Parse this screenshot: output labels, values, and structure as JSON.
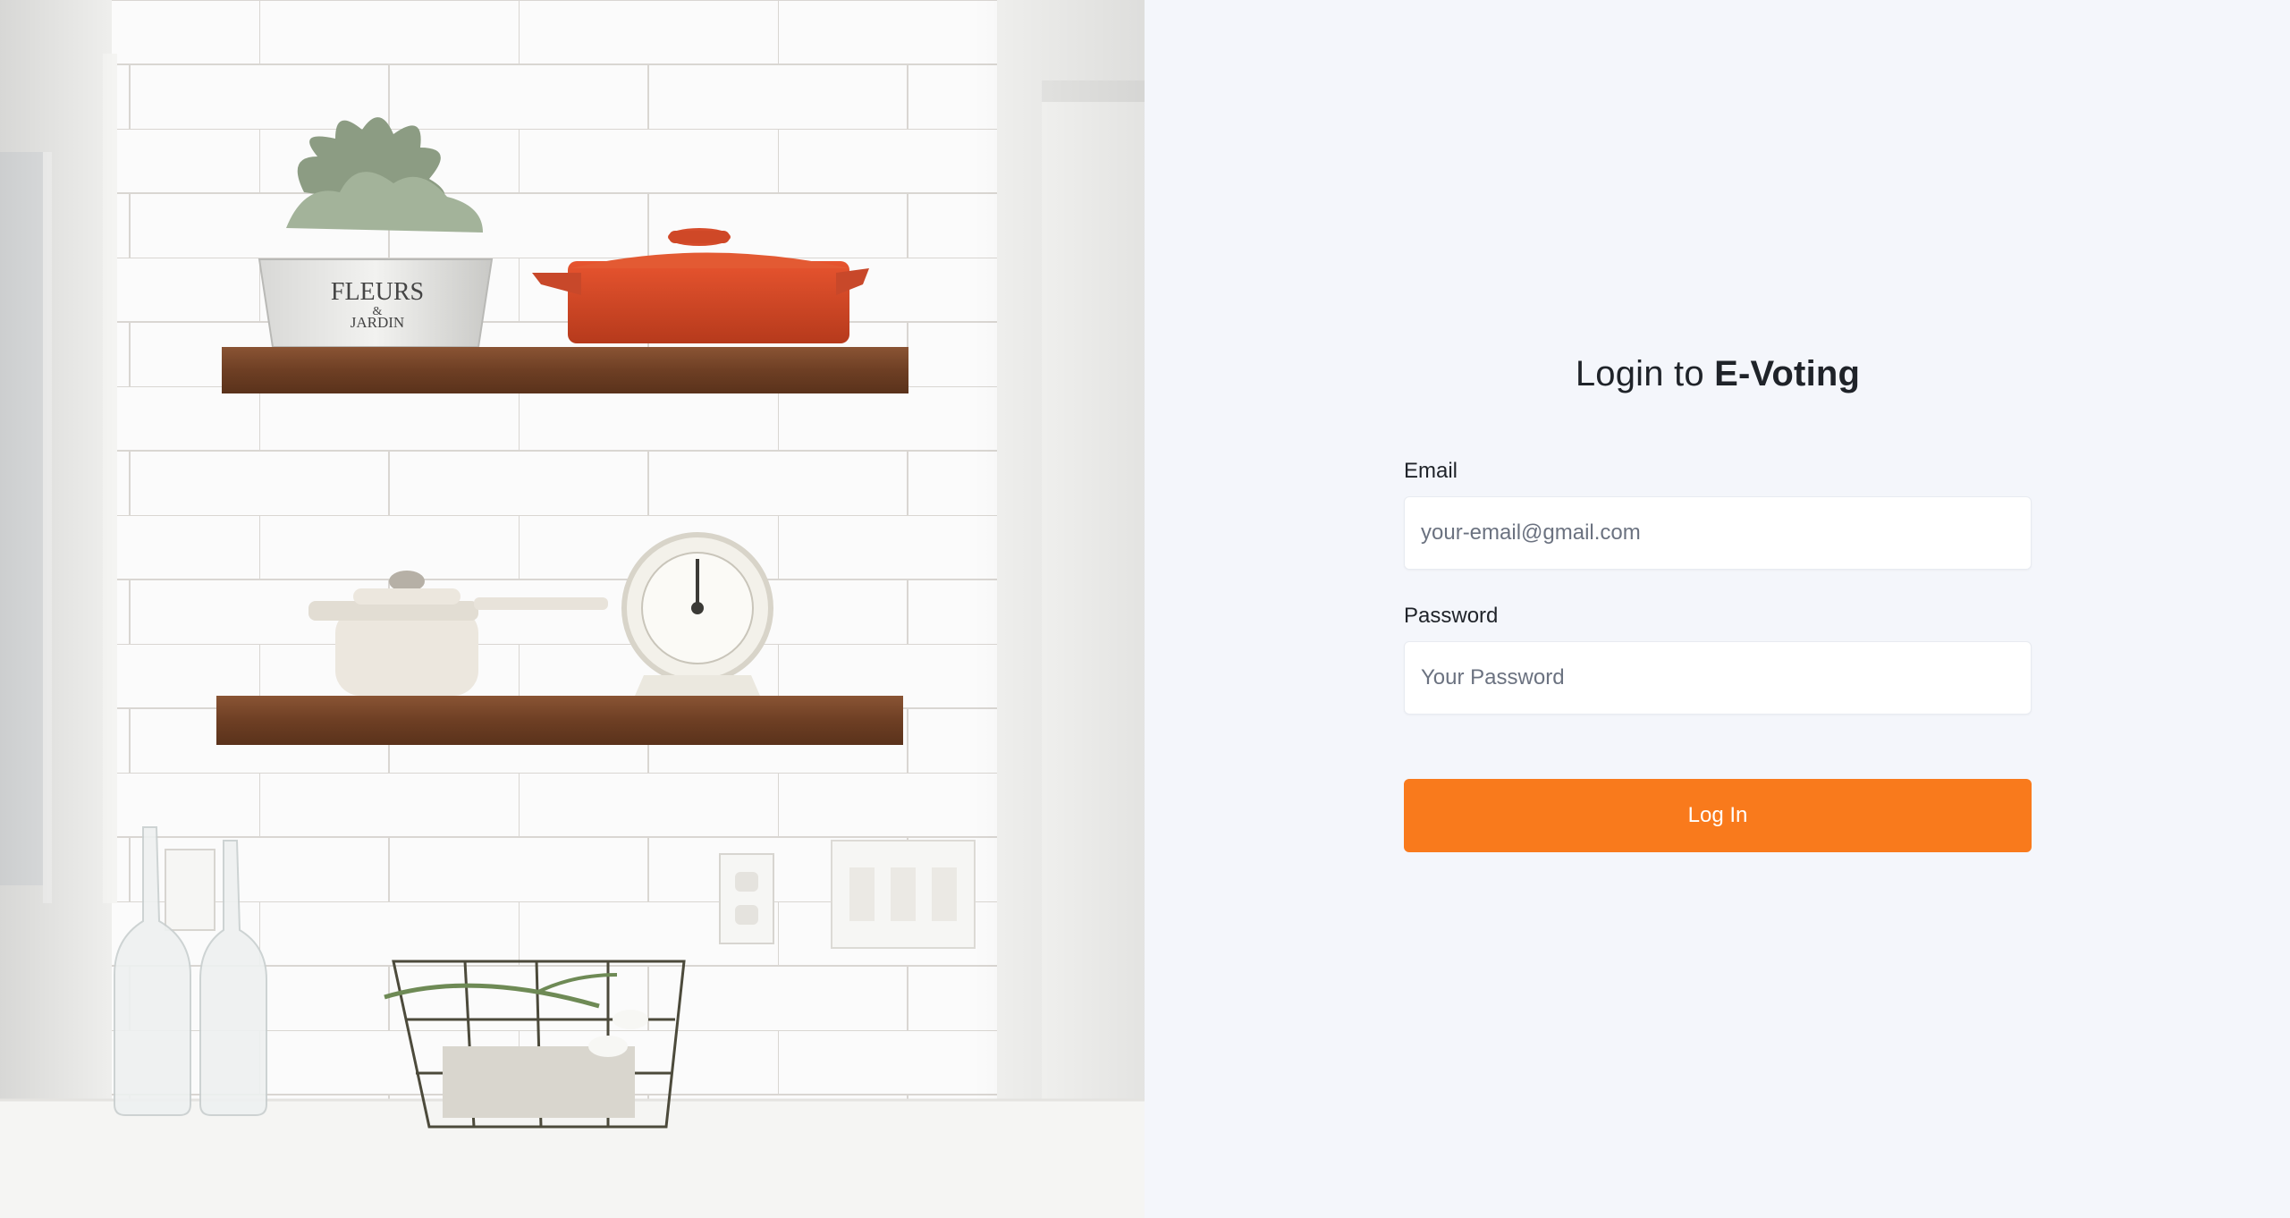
{
  "login": {
    "title_prefix": "Login to ",
    "title_brand": "E-Voting",
    "email": {
      "label": "Email",
      "placeholder": "your-email@gmail.com",
      "value": ""
    },
    "password": {
      "label": "Password",
      "placeholder": "Your Password",
      "value": ""
    },
    "submit_label": "Log In"
  },
  "photo": {
    "planter_text": [
      "FLEURS",
      "&",
      "JARDIN"
    ]
  },
  "colors": {
    "accent": "#f97a1c",
    "background": "#f4f6fb",
    "text": "#1f2329"
  }
}
